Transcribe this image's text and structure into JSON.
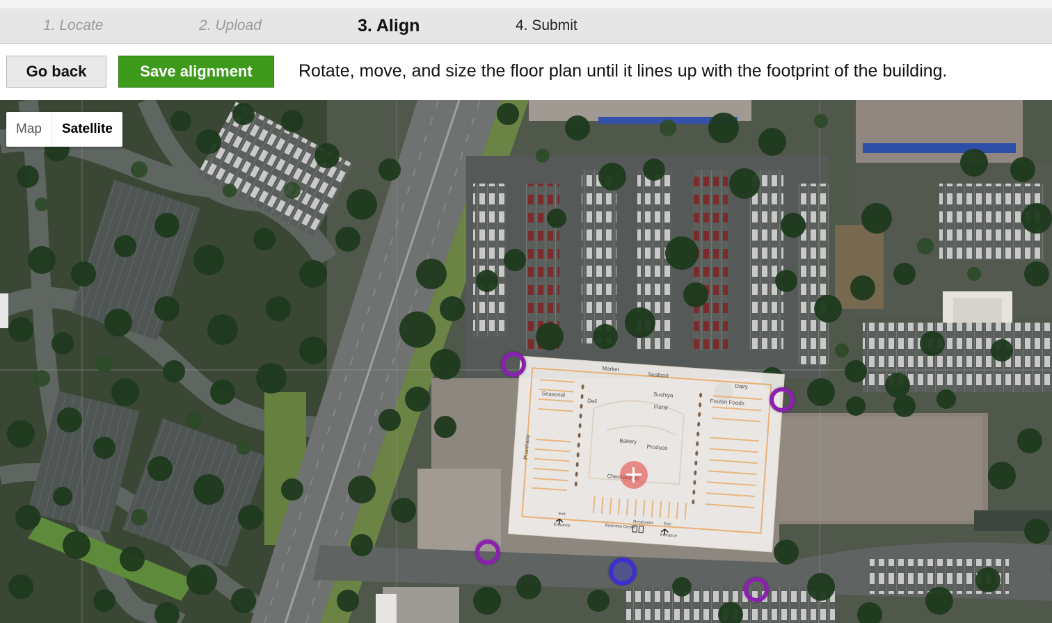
{
  "steps": [
    {
      "label": "1. Locate"
    },
    {
      "label": "2. Upload"
    },
    {
      "label": "3. Align"
    },
    {
      "label": "4. Submit"
    }
  ],
  "toolbar": {
    "back_label": "Go back",
    "save_label": "Save alignment",
    "instructions": "Rotate, move, and size the floor plan until it lines up with the footprint of the building."
  },
  "map_type": {
    "options": [
      "Map",
      "Satellite"
    ],
    "selected": "Satellite"
  },
  "floor_plan": {
    "labels": {
      "market": "Market",
      "seafood": "Seafood",
      "dairy": "Dairy",
      "sushiya": "Sushiya",
      "frozen": "Frozen Foods",
      "seasonal": "Seasonal",
      "deli": "Deli",
      "floral": "Floral",
      "pharmacy": "Pharmacy",
      "bakery": "Bakery",
      "produce": "Produce",
      "checkstands": "Checkstands",
      "exit_left": "Exit",
      "entrance_left": "Entrance",
      "business_center": "Business Center",
      "restrooms": "Restrooms",
      "exit_right": "Exit",
      "entrance_right": "Entrance"
    }
  },
  "colors": {
    "save_green": "#3d9a1b",
    "handle_purple": "#8a1fb0",
    "center_handle_blue": "#3b2fd0",
    "plan_orange": "#e8a25a"
  }
}
